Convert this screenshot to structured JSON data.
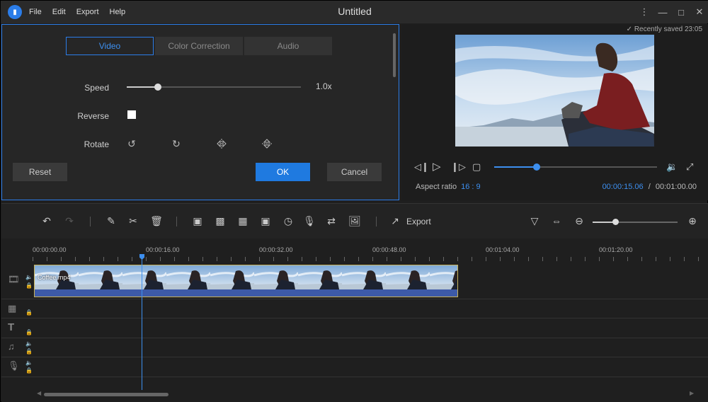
{
  "app": {
    "title": "Untitled",
    "menu": [
      "File",
      "Edit",
      "Export",
      "Help"
    ]
  },
  "window_controls": [
    "more-vertical-icon",
    "minimize-icon",
    "maximize-icon",
    "close-icon"
  ],
  "edit_panel": {
    "tabs": [
      {
        "label": "Video",
        "active": true
      },
      {
        "label": "Color Correction",
        "active": false
      },
      {
        "label": "Audio",
        "active": false
      }
    ],
    "speed": {
      "label": "Speed",
      "value": "1.0x",
      "fraction": 0.18
    },
    "reverse": {
      "label": "Reverse",
      "checked": false
    },
    "rotate": {
      "label": "Rotate",
      "icons": [
        "rotate-left-icon",
        "rotate-right-icon",
        "flip-horizontal-icon",
        "flip-vertical-icon"
      ]
    },
    "buttons": {
      "reset": "Reset",
      "ok": "OK",
      "cancel": "Cancel"
    }
  },
  "preview": {
    "saved_text": "Recently saved 23:05",
    "aspect_label": "Aspect ratio",
    "aspect_value": "16 : 9",
    "current_time": "00:00:15.06",
    "separator": "/",
    "total_time": "00:01:00.00",
    "progress_fraction": 0.26
  },
  "toolbar": {
    "export_label": "Export",
    "zoom_fraction": 0.27
  },
  "timeline": {
    "ruler_labels": [
      "00:00:00.00",
      "00:00:16.00",
      "00:00:32.00",
      "00:00:48.00",
      "00:01:04.00",
      "00:01:20.00"
    ],
    "clip_name": "Coffee.mp4",
    "tracks": [
      "video-track",
      "pip-track",
      "text-track",
      "music-track",
      "voice-track"
    ]
  },
  "colors": {
    "accent": "#2b7de9",
    "clip_border": "#c8b35a",
    "clip_audio": "#3d5aa8"
  }
}
